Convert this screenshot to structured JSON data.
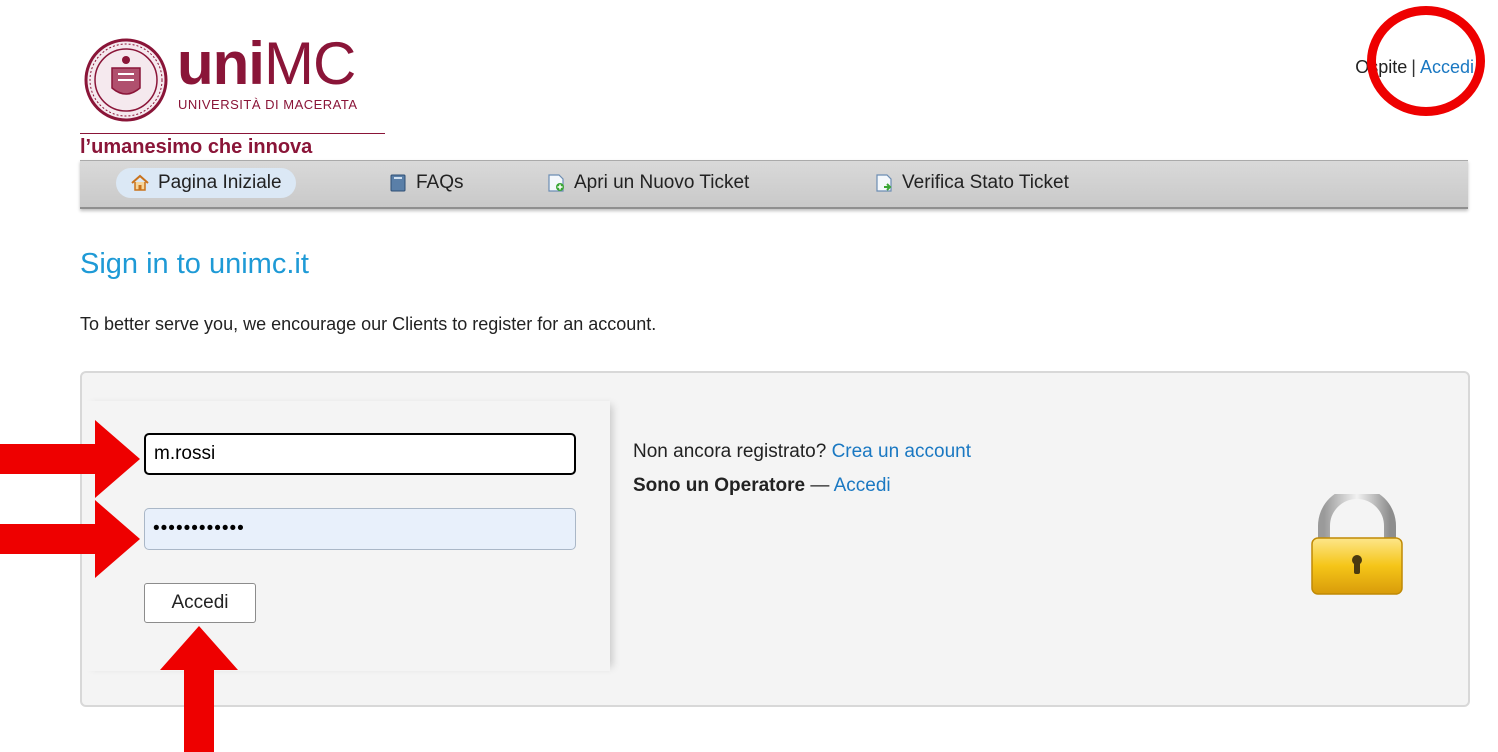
{
  "brand": {
    "logo_bold": "uni",
    "logo_light": "MC",
    "university": "UNIVERSITÀ DI MACERATA",
    "tagline": "l’umanesimo che innova",
    "color": "#8a1538"
  },
  "userbar": {
    "guest": "Ospite",
    "separator": "|",
    "login": "Accedi"
  },
  "nav": {
    "items": [
      {
        "label": "Pagina Iniziale",
        "icon": "home-icon",
        "active": true
      },
      {
        "label": "FAQs",
        "icon": "book-icon",
        "active": false
      },
      {
        "label": "Apri un Nuovo Ticket",
        "icon": "new-ticket-icon",
        "active": false
      },
      {
        "label": "Verifica Stato Ticket",
        "icon": "ticket-status-icon",
        "active": false
      }
    ]
  },
  "page": {
    "title": "Sign in to unimc.it",
    "intro": "To better serve you, we encourage our Clients to register for an account."
  },
  "login": {
    "username_value": "m.rossi",
    "password_value": "••••••••••••",
    "submit_label": "Accedi"
  },
  "side": {
    "not_registered": "Non ancora registrato?",
    "create_account": "Crea un account",
    "agent": "Sono un Operatore",
    "dash": "—",
    "agent_login": "Accedi"
  },
  "colors": {
    "link": "#1a78c2",
    "title": "#1e9ad6",
    "annotation": "#ee0000"
  }
}
